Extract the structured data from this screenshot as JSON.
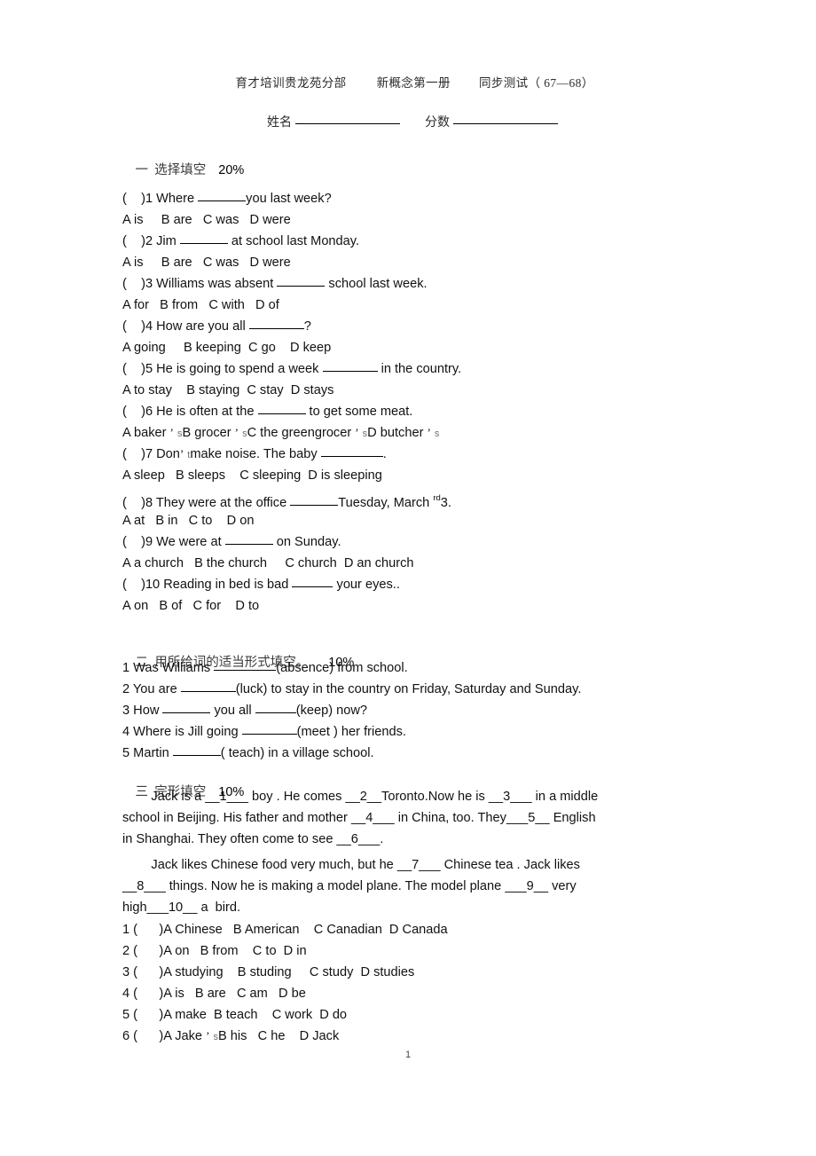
{
  "document": {
    "header": {
      "institution": "育才培训贵龙苑分部",
      "book": "新概念第一册",
      "test": "同步测试（ 67—68）"
    },
    "name_score": {
      "name_label": "姓名",
      "score_label": "分数"
    },
    "page_number": "1"
  },
  "section_one": {
    "heading": "一  选择填空",
    "points": "20%",
    "questions": [
      {
        "stem_pre": "(    )1 Where ",
        "blank": "w6",
        "stem_post": "you last week?",
        "options": "A is     B are   C was   D were"
      },
      {
        "stem_pre": "(    )2 Jim ",
        "blank": "w6",
        "stem_post": " at school last Monday.",
        "options": "A is     B are   C was   D were"
      },
      {
        "stem_pre": "(    )3 Williams was absent ",
        "blank": "w6",
        "stem_post": " school last week.",
        "options": "A for   B from   C with   D of"
      },
      {
        "stem_pre": "(    )4 How are you all ",
        "blank": "w7",
        "stem_post": "?",
        "options": "A going     B keeping  C go    D keep"
      },
      {
        "stem_pre": "(    )5 He is going to spend a week ",
        "blank": "w7",
        "stem_post": " in the country.",
        "options": "A to stay    B staying  C stay  D stays"
      },
      {
        "stem_pre": "(    )6 He is often at the ",
        "blank": "w6",
        "stem_post": " to get some meat.",
        "options_html": "A baker <span class=\"apos\">’</span> <span class=\"tiny\">s</span>B grocer <span class=\"apos\">’</span> <span class=\"tiny\">s</span>C the greengrocer <span class=\"apos\">’</span> <span class=\"tiny\">s</span>D butcher <span class=\"apos\">’</span> <span class=\"tiny\">s</span>"
      },
      {
        "stem_pre_html": "(    )7 Don<span class=\"apos\">’</span> <span class=\"tiny\">t</span>make noise. The baby ",
        "blank": "w8",
        "stem_post": ".",
        "options": "A sleep   B sleeps    C sleeping  D is sleeping"
      },
      {
        "stem_pre": "(    )8 They were at the office ",
        "blank": "w6",
        "stem_post_html": "Tuesday, March <span class=\"sup-rd\">rd</span>3.",
        "options": "A at   B in   C to    D on"
      },
      {
        "stem_pre": "(    )9 We were at ",
        "blank": "w6",
        "stem_post": " on Sunday.",
        "options": "A a church   B the church     C church  D an church"
      },
      {
        "stem_pre": "(    )10 Reading in bed is bad ",
        "blank": "w5",
        "stem_post": " your eyes..",
        "options": "A on   B of   C for    D to"
      }
    ]
  },
  "section_two": {
    "heading": "二  用所给词的适当形式填空。",
    "points": "10%",
    "items": [
      {
        "pre": "1 Was Williams ",
        "blank": "w8",
        "post": "(absence) from school."
      },
      {
        "pre": "2 You are ",
        "blank": "w7",
        "post": "(luck) to stay in the country on Friday, Saturday and Sunday."
      },
      {
        "pre": "3 How ",
        "blank": "w6",
        "post": " you all ",
        "blank2": "w5",
        "post2": "(keep) now?"
      },
      {
        "pre": "4 Where is Jill going ",
        "blank": "w7",
        "post": "(meet ) her friends."
      },
      {
        "pre": "5 Martin ",
        "blank": "w6",
        "post": "( teach) in a village school."
      }
    ]
  },
  "section_three": {
    "heading": "三  完形填空",
    "points": "10%",
    "passage": [
      "        Jack is a __1___ boy . He comes __2__Toronto.Now he is __3___ in a middle",
      "school in Beijing. His father and mother __4___ in China, too. They___5__ English",
      "in Shanghai. They often come to see __6___.",
      "        Jack likes Chinese food very much, but he __7___ Chinese tea . Jack likes",
      "__8___ things. Now he is making a model plane. The model plane ___9__ very",
      "high___10__ a  bird."
    ],
    "choices": [
      "1 (      )A Chinese   B American    C Canadian  D Canada",
      "2 (      )A on   B from    C to  D in",
      "3 (      )A studying    B studing     C study  D studies",
      "4 (      )A is   B are   C am   D be",
      "5 (      )A make  B teach    C work  D do"
    ],
    "choice_six_html": "6 (      )A Jake <span class=\"apos\">’</span> <span class=\"tiny\">s</span>B his   C he    D Jack"
  }
}
